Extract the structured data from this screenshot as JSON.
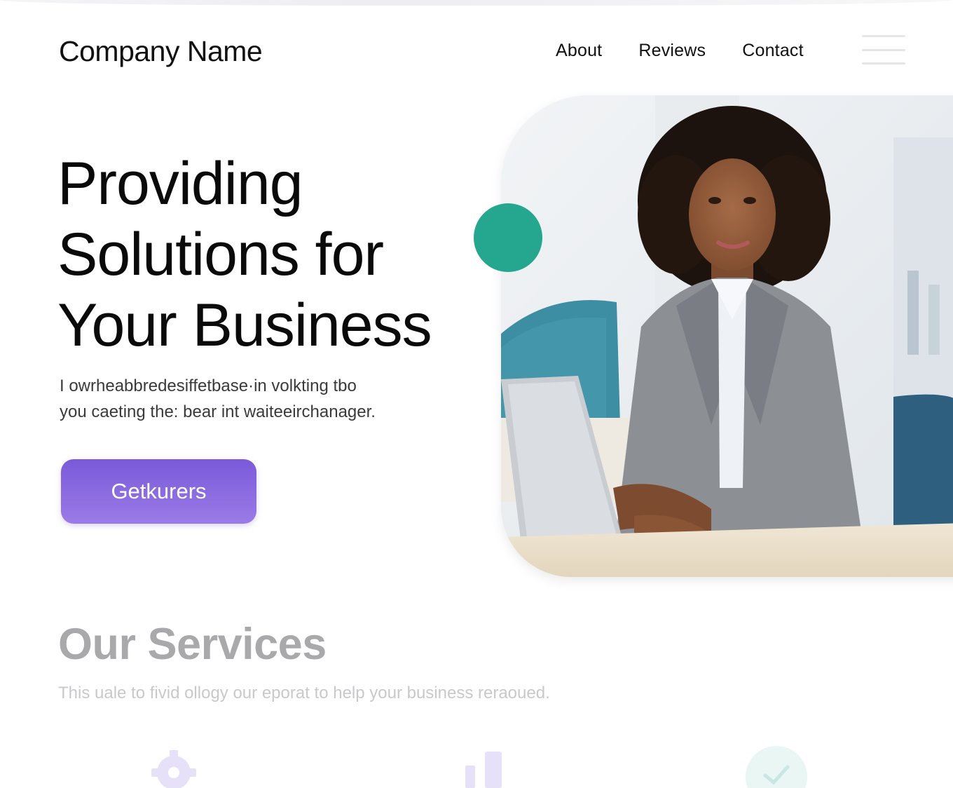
{
  "header": {
    "brand": "Company Name",
    "nav": [
      {
        "label": "About"
      },
      {
        "label": "Reviews"
      },
      {
        "label": "Contact"
      }
    ],
    "menu_icon": "hamburger-menu-icon"
  },
  "hero": {
    "title_lines": [
      "Providing",
      "Solutions for",
      "Your Business"
    ],
    "text_lines": [
      "I owrheabbredesiffetbase·in volkting tbo",
      "you caeting the: bear int waiteeirchanager."
    ],
    "cta_label": "Getkurers",
    "image": "businesswoman-at-laptop-photo"
  },
  "services": {
    "title": "Our Services",
    "subtitle": "This uale to fivid ollogy our eporat to help your business reraoued.",
    "icons": [
      "gear-icon",
      "bar-chart-icon",
      "check-circle-icon"
    ]
  },
  "colors": {
    "accent_teal": "#25a78f",
    "cta_purple": "#7b5ad9",
    "services_title": "#a9a9ab"
  }
}
